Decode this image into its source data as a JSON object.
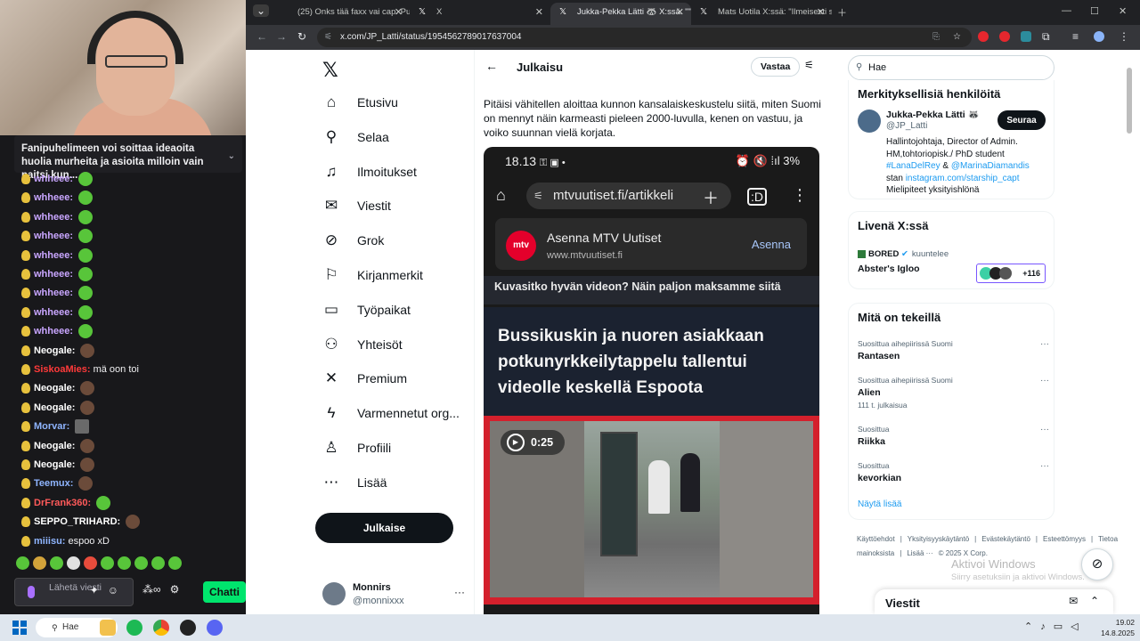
{
  "stream": {
    "pinned_message": "Fanipuhelimeen voi soittaa ideaoita huolia murheita ja asioita milloin vain paitsi kun...",
    "chat": [
      {
        "user": "whheee:",
        "color": "#c9a6ff",
        "msg": "",
        "emote": "green"
      },
      {
        "user": "whheee:",
        "color": "#c9a6ff",
        "msg": "",
        "emote": "green"
      },
      {
        "user": "whheee:",
        "color": "#c9a6ff",
        "msg": "",
        "emote": "green"
      },
      {
        "user": "whheee:",
        "color": "#c9a6ff",
        "msg": "",
        "emote": "green"
      },
      {
        "user": "whheee:",
        "color": "#c9a6ff",
        "msg": "",
        "emote": "green"
      },
      {
        "user": "whheee:",
        "color": "#c9a6ff",
        "msg": "",
        "emote": "green"
      },
      {
        "user": "whheee:",
        "color": "#c9a6ff",
        "msg": "",
        "emote": "green"
      },
      {
        "user": "whheee:",
        "color": "#c9a6ff",
        "msg": "",
        "emote": "green"
      },
      {
        "user": "whheee:",
        "color": "#c9a6ff",
        "msg": "",
        "emote": "green"
      },
      {
        "user": "Neogale:",
        "color": "#ffffff",
        "msg": "",
        "emote": "face"
      },
      {
        "user": "SiskoaMies:",
        "color": "#ff3a3a",
        "msg": "mä oon toi",
        "emote": ""
      },
      {
        "user": "Neogale:",
        "color": "#ffffff",
        "msg": "",
        "emote": "face"
      },
      {
        "user": "Neogale:",
        "color": "#ffffff",
        "msg": "",
        "emote": "face"
      },
      {
        "user": "Morvar:",
        "color": "#8fb5ff",
        "msg": "",
        "emote": "grey"
      },
      {
        "user": "Neogale:",
        "color": "#ffffff",
        "msg": "",
        "emote": "face"
      },
      {
        "user": "Neogale:",
        "color": "#ffffff",
        "msg": "",
        "emote": "face"
      },
      {
        "user": "Teemux:",
        "color": "#8fb5ff",
        "msg": "",
        "emote": "face"
      },
      {
        "user": "DrFrank360:",
        "color": "#ff5a5a",
        "msg": "",
        "emote": "green"
      },
      {
        "user": "SEPPO_TRIHARD:",
        "color": "#ffffff",
        "msg": "",
        "emote": "face"
      },
      {
        "user": "miiisu:",
        "color": "#8fb5ff",
        "msg": "espoo xD",
        "emote": ""
      }
    ],
    "input_placeholder": "Lähetä viesti",
    "chat_button": "Chatti"
  },
  "browser": {
    "tabs": [
      {
        "title": "(25) Onks tää faxx vai cap: Puu",
        "active": false,
        "fav_color": "#ff0000"
      },
      {
        "title": "X",
        "active": false,
        "fav_color": "#ffffff"
      },
      {
        "title": "Jukka-Pekka Lätti 🦝 X:ssä: \"\"B",
        "active": true,
        "fav_color": "#ffffff"
      },
      {
        "title": "Mats Uotila X:ssä: \"Ilmeisesti si",
        "active": false,
        "fav_color": "#ffffff"
      }
    ],
    "url": "x.com/JP_Latti/status/1954562789017637004"
  },
  "x": {
    "nav": [
      {
        "label": "Etusivu",
        "icon": "⌂",
        "name": "home"
      },
      {
        "label": "Selaa",
        "icon": "⚲",
        "name": "explore"
      },
      {
        "label": "Ilmoitukset",
        "icon": "♫",
        "name": "notifications"
      },
      {
        "label": "Viestit",
        "icon": "✉",
        "name": "messages"
      },
      {
        "label": "Grok",
        "icon": "⊘",
        "name": "grok"
      },
      {
        "label": "Kirjanmerkit",
        "icon": "⚐",
        "name": "bookmarks"
      },
      {
        "label": "Työpaikat",
        "icon": "▭",
        "name": "jobs"
      },
      {
        "label": "Yhteisöt",
        "icon": "⚇",
        "name": "communities"
      },
      {
        "label": "Premium",
        "icon": "✕",
        "name": "premium"
      },
      {
        "label": "Varmennetut org...",
        "icon": "ϟ",
        "name": "verified-orgs"
      },
      {
        "label": "Profiili",
        "icon": "♙",
        "name": "profile"
      },
      {
        "label": "Lisää",
        "icon": "⋯",
        "name": "more"
      }
    ],
    "post_button": "Julkaise",
    "account": {
      "name": "Monnirs",
      "handle": "@monnixxx"
    },
    "header_title": "Julkaisu",
    "reply_button": "Vastaa",
    "post_text": "Pitäisi vähitellen aloittaa kunnon kansalaiskeskustelu siitä, miten Suomi on mennyt näin karmeasti pieleen 2000-luvulla, kenen on vastuu, ja voiko suunnan vielä korjata.",
    "screenshot": {
      "time": "18.13",
      "status_icons": "⏰ 🔇 ⁞ıl 3%",
      "url": "mtvuutiset.fi/artikkeli",
      "install_title": "Asenna MTV Uutiset",
      "install_url": "www.mtvuutiset.fi",
      "install_button": "Asenna",
      "logo_text": "mtv",
      "teaser": "Kuvasitko hyvän videon? Näin paljon maksamme siitä",
      "headline": "Bussikuskin ja nuoren asiakkaan potkunyrkkeilytappelu tallentui videolle keskellä Espoota",
      "duration": "0:25"
    },
    "search_placeholder": "Hae",
    "relevant": {
      "title": "Merkityksellisiä henkilöitä",
      "name": "Jukka-Pekka Lätti 🦝",
      "handle": "@JP_Latti",
      "follow_button": "Seuraa",
      "bio_line1": "Hallintojohtaja, Director of Admin. HM,tohtoriopisk./ PhD student",
      "bio_link1": "#LanaDelRey",
      "bio_amp": " & ",
      "bio_link2": "@MarinaDiamandis",
      "bio_stan": "stan ",
      "bio_link3": "instagram.com/starship_capt",
      "bio_line3": "Mielipiteet yksityishlönä"
    },
    "live": {
      "title": "Livenä X:ssä",
      "host": "BORED",
      "host_status": "kuuntelee",
      "room": "Abster's Igloo",
      "listeners": "+116"
    },
    "trends": {
      "title": "Mitä on tekeillä",
      "items": [
        {
          "context": "Suosittua aihepiirissä Suomi",
          "name": "Rantasen",
          "count": ""
        },
        {
          "context": "Suosittua aihepiirissä Suomi",
          "name": "Alien",
          "count": "111 t. julkaisua"
        },
        {
          "context": "Suosittua",
          "name": "Riikka",
          "count": ""
        },
        {
          "context": "Suosittua",
          "name": "kevorkian",
          "count": ""
        }
      ],
      "show_more": "Näytä lisää"
    },
    "footer": [
      "Käyttöehdot",
      "|",
      "Yksityisyyskäytäntö",
      "|",
      "Evästekäytäntö",
      "|",
      "Esteettömyys",
      "|",
      "Tietoa mainoksista",
      "|",
      "Lisää ···",
      "© 2025 X Corp."
    ],
    "messages_drawer": "Viestit"
  },
  "windows": {
    "activate_title": "Aktivoi Windows",
    "activate_sub": "Siirry asetuksiin ja aktivoi Windows.",
    "search": "Hae",
    "time": "19.02",
    "date": "14.8.2025"
  }
}
